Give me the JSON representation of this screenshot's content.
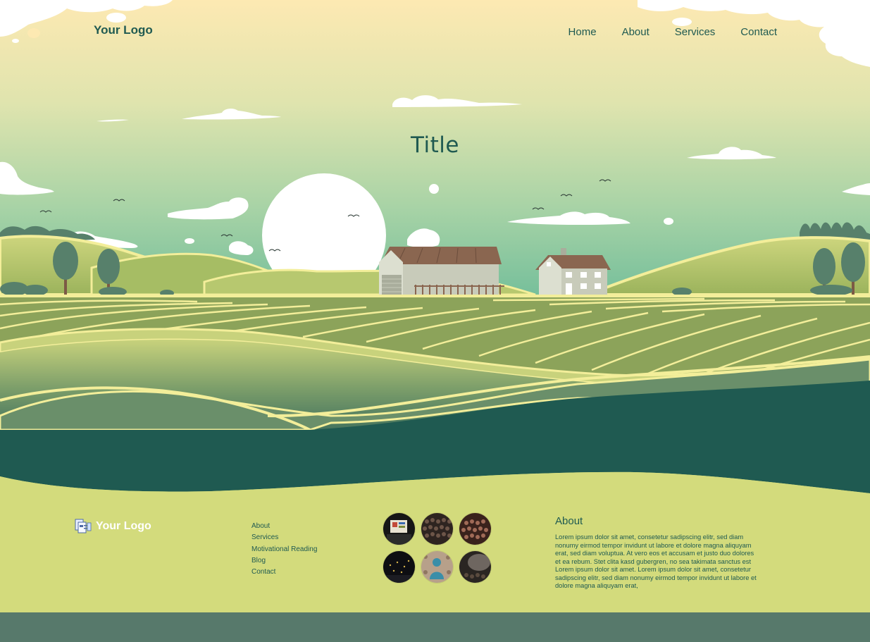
{
  "header": {
    "logo_text": "Your Logo",
    "nav": [
      "Home",
      "About",
      "Services",
      "Contact"
    ]
  },
  "hero": {
    "title": "Title"
  },
  "footer": {
    "logo_text": "Your Logo",
    "links": [
      "About",
      "Services",
      "Motivational Reading",
      "Blog",
      "Contact"
    ],
    "gallery_count": 6,
    "about_heading": "About",
    "about_text": "Lorem ipsum dolor sit amet, consetetur sadipscing elitr, sed diam nonumy eirmod tempor invidunt ut labore et dolore magna aliquyam erat, sed diam voluptua. At vero eos et accusam et justo duo dolores et ea rebum. Stet clita kasd gubergren, no sea takimata sanctus est Lorem ipsum dolor sit amet. Lorem ipsum dolor sit amet, consetetur sadipscing elitr, sed diam nonumy eirmod tempor invidunt ut labore et dolore magna aliquyam erat,"
  },
  "colors": {
    "sky_top": "#fde9b2",
    "sky_bottom": "#7cc29d",
    "dark_green": "#1f5a51",
    "field_green": "#8ca35a",
    "stripe_yellow": "#f3ee9a",
    "footer_green": "#d3db7c",
    "bottom_bar": "#57796b",
    "tree_green": "#57806b",
    "roof_brown": "#8a6650"
  }
}
